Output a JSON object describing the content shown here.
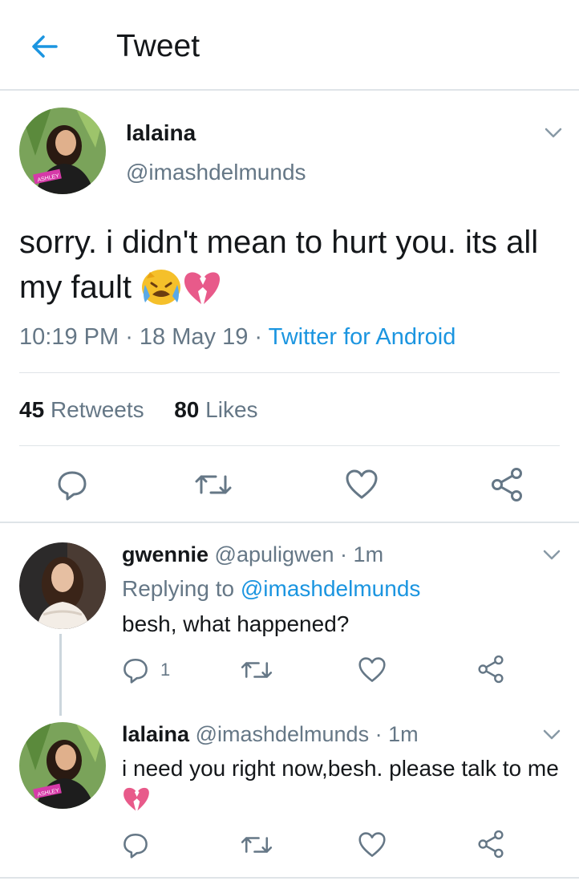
{
  "header": {
    "title": "Tweet"
  },
  "tweet": {
    "name": "lalaina",
    "handle": "@imashdelmunds",
    "text": "sorry. i didn't mean to hurt you. its all my fault",
    "time": "10:19 PM",
    "date": "18 May 19",
    "source": "Twitter for Android",
    "retweets_count": "45",
    "retweets_label": "Retweets",
    "likes_count": "80",
    "likes_label": "Likes",
    "avatar_label": "ASHLEY"
  },
  "replies": [
    {
      "name": "gwennie",
      "handle": "@apuligwen",
      "time": "1m",
      "replying_prefix": "Replying to",
      "replying_handle": "@imashdelmunds",
      "text": "besh, what happened?",
      "reply_count": "1"
    },
    {
      "name": "lalaina",
      "handle": "@imashdelmunds",
      "time": "1m",
      "text": "i need you right now,besh. please talk to me"
    }
  ],
  "colors": {
    "accent": "#1b95e0",
    "secondary_text": "#657786",
    "divider": "#dfe4e8"
  },
  "icons": [
    "back-arrow-icon",
    "chevron-down-icon",
    "reply-icon",
    "retweet-icon",
    "like-icon",
    "share-icon",
    "crying-face-emoji",
    "broken-heart-emoji"
  ]
}
